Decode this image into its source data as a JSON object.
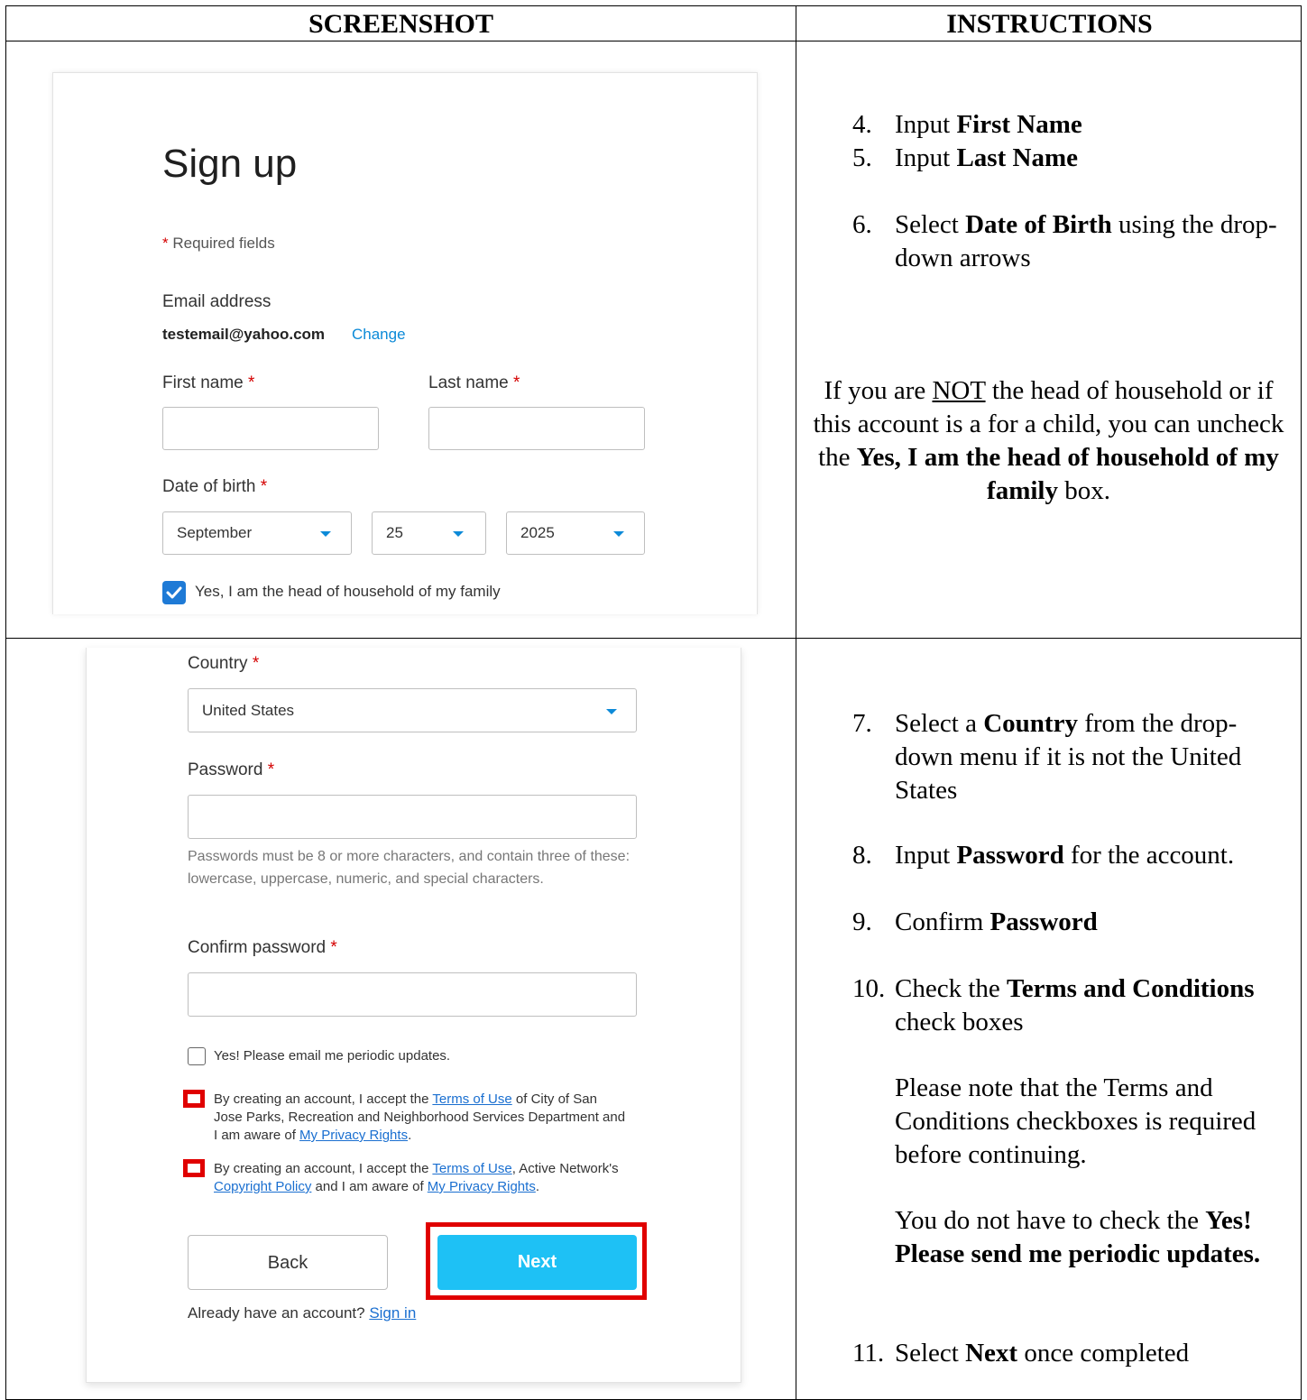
{
  "table": {
    "header_left": "SCREENSHOT",
    "header_right": "INSTRUCTIONS"
  },
  "screenshot1": {
    "title": "Sign up",
    "required_star": "*",
    "required_text": " Required fields",
    "email_label": "Email address",
    "email_value": "testemail@yahoo.com",
    "change_link": "Change",
    "first_name_label": "First name",
    "last_name_label": "Last name",
    "dob_label": "Date of birth",
    "dob_month": "September",
    "dob_day": "25",
    "dob_year": "2025",
    "head_of_household": "Yes, I am the head of household of my family",
    "star": "*"
  },
  "screenshot2": {
    "country_label": "Country",
    "country_value": "United States",
    "password_label": "Password",
    "password_hint": "Passwords must be 8 or more characters, and contain three of these: lowercase, uppercase, numeric, and special characters.",
    "confirm_label": "Confirm password",
    "updates_label": "Yes! Please email me periodic updates.",
    "terms1_pre": "By creating an account, I accept the ",
    "terms1_link": "Terms of Use",
    "terms1_mid": " of City of San Jose Parks, Recreation and Neighborhood Services Department and I am aware of ",
    "terms1_link2": "My Privacy Rights",
    "terms1_end": ".",
    "terms2_pre": "By creating an account, I accept the ",
    "terms2_link": "Terms of Use",
    "terms2_mid": ", Active Network's ",
    "terms2_link2": "Copyright Policy",
    "terms2_mid2": " and I am aware of ",
    "terms2_link3": "My Privacy Rights",
    "terms2_end": ".",
    "back_button": "Back",
    "next_button": "Next",
    "signin_pre": "Already have an account? ",
    "signin_link": "Sign in",
    "star": "*"
  },
  "instructions1": {
    "s4_num": "4.",
    "s4_pre": "Input ",
    "s4_bold": "First Name",
    "s5_num": "5.",
    "s5_pre": "Input ",
    "s5_bold": "Last Name",
    "s6_num": "6.",
    "s6_pre": "Select ",
    "s6_bold": "Date of Birth",
    "s6_post": " using the drop-down arrows",
    "note_pre": "If you are ",
    "note_not": "NOT",
    "note_mid": " the head of household or if this account is a for a child, you can uncheck the ",
    "note_bold": "Yes, I am the head of household of my family",
    "note_post": " box."
  },
  "instructions2": {
    "s7_num": "7.",
    "s7_pre": "Select a ",
    "s7_bold": "Country",
    "s7_post": " from the drop-down menu if it is not the United States",
    "s8_num": "8.",
    "s8_pre": "Input ",
    "s8_bold": "Password",
    "s8_post": " for the account.",
    "s9_num": "9.",
    "s9_pre": "Confirm ",
    "s9_bold": "Password",
    "s10_num": "10.",
    "s10_pre": "Check the ",
    "s10_bold": "Terms and Conditions",
    "s10_post": " check boxes",
    "note1": "Please note that the Terms and Conditions checkboxes is required before continuing.",
    "note2_pre": "You do not have to check the ",
    "note2_bold": "Yes! Please send me periodic updates.",
    "s11_num": "11.",
    "s11_pre": "Select ",
    "s11_bold": "Next",
    "s11_post": " once completed"
  }
}
